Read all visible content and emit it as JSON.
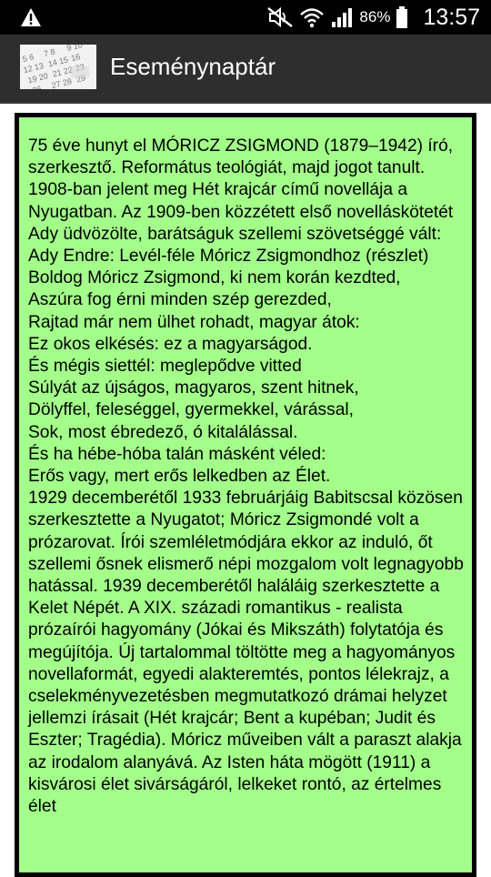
{
  "status_bar": {
    "battery": "86%",
    "time": "13:57",
    "icons": [
      "warning-icon",
      "mute-icon",
      "wifi-icon",
      "signal-icon",
      "battery-icon"
    ]
  },
  "action_bar": {
    "title": "Eseménynaptár",
    "icon": "calendar-thumbnail-icon"
  },
  "content": {
    "background": "#a3ff8a",
    "text": "75 éve hunyt el MÓRICZ ZSIGMOND (1879–1942) író, szerkesztő. Református teológiát, majd jogot tanult. 1908-ban jelent meg Hét krajcár című novellája a Nyugatban. Az 1909-ben közzétett első novelláskötetét Ady üdvözölte, barátságuk szellemi szövetséggé vált: Ady Endre: Levél-féle Móricz Zsigmondhoz (részlet)\nBoldog Móricz Zsigmond, ki nem korán kezdted,\nAszúra fog érni minden szép gerezded,\nRajtad már nem ülhet rohadt, magyar átok:\nEz okos elkésés: ez a magyarságod.\nÉs mégis siettél: meglepődve vitted\nSúlyát az újságos, magyaros, szent hitnek,\nDölyffel, feleséggel, gyermekkel, várással,\nSok, most ébredező, ó kitalálással.\nÉs ha hébe-hóba talán másként véled:\nErős vagy, mert erős lelkedben az Élet.\n1929 decemberétől 1933 februárjáig Babitscsal közösen szerkesztette a Nyugatot; Móricz Zsigmondé volt a prózarovat. Írói szemléletmódjára ekkor az induló, őt szellemi ősnek elismerő népi mozgalom volt legnagyobb hatással. 1939 decemberétől haláláig szerkesztette a Kelet Népét. A XIX. századi romantikus - realista prózaírói hagyomány (Jókai és Mikszáth) folytatója és megújítója. Új tartalommal töltötte meg a hagyományos novellaformát, egyedi alakteremtés, pontos lélekrajz, a cselekményvezetésben megmutatkozó drámai helyzet jellemzi írásait (Hét krajcár; Bent a kupéban; Judit és Eszter; Tragédia). Móricz műveiben vált a paraszt alakja az irodalom alanyává. Az Isten háta mögött (1911) a kisvárosi élet sivárságáról, lelkeket rontó, az értelmes élet"
  }
}
